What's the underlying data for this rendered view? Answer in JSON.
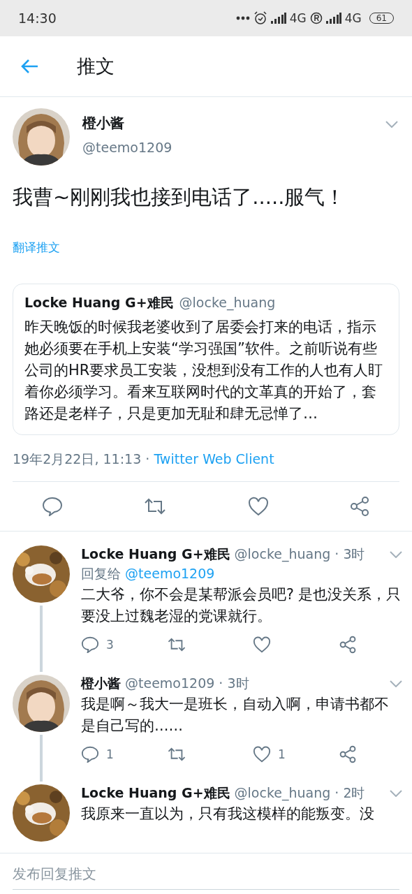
{
  "status_bar": {
    "time": "14:30",
    "network_1": "4G",
    "network_2": "4G",
    "battery": "61"
  },
  "header": {
    "title": "推文"
  },
  "tweet": {
    "name": "橙小酱",
    "handle": "@teemo1209",
    "text": "我曹~刚刚我也接到电话了.....服气！",
    "translate": "翻译推文",
    "quote": {
      "name": "Locke Huang G+难民",
      "handle": "@locke_huang",
      "text": "昨天晚饭的时候我老婆收到了居委会打来的电话，指示她必须要在手机上安装“学习强国”软件。之前听说有些公司的HR要求员工安装，没想到没有工作的人也有人盯着你必须学习。看来互联网时代的文革真的开始了，套路还是老样子，只是更加无耻和肆无忌惮了…"
    },
    "date": "19年2月22日, 11:13 · ",
    "source": "Twitter Web Client"
  },
  "replies": [
    {
      "name": "Locke Huang G+难民",
      "handle": "@locke_huang · 3时",
      "reply_label": "回复给",
      "reply_to": "@teemo1209",
      "text": "二大爷，你不会是某帮派会员吧? 是也没关系，只要没上过魏老湿的党课就行。",
      "counts": {
        "reply": "3"
      }
    },
    {
      "name": "橙小酱",
      "handle": "@teemo1209 · 3时",
      "text": "我是啊～我大一是班长，自动入啊，申请书都不是自己写的……",
      "counts": {
        "reply": "1",
        "like": "1"
      }
    },
    {
      "name": "Locke Huang G+难民",
      "handle": "@locke_huang · 2时",
      "text": "我原来一直以为，只有我这模样的能叛变。没"
    }
  ],
  "compose": {
    "placeholder": "发布回复推文"
  }
}
